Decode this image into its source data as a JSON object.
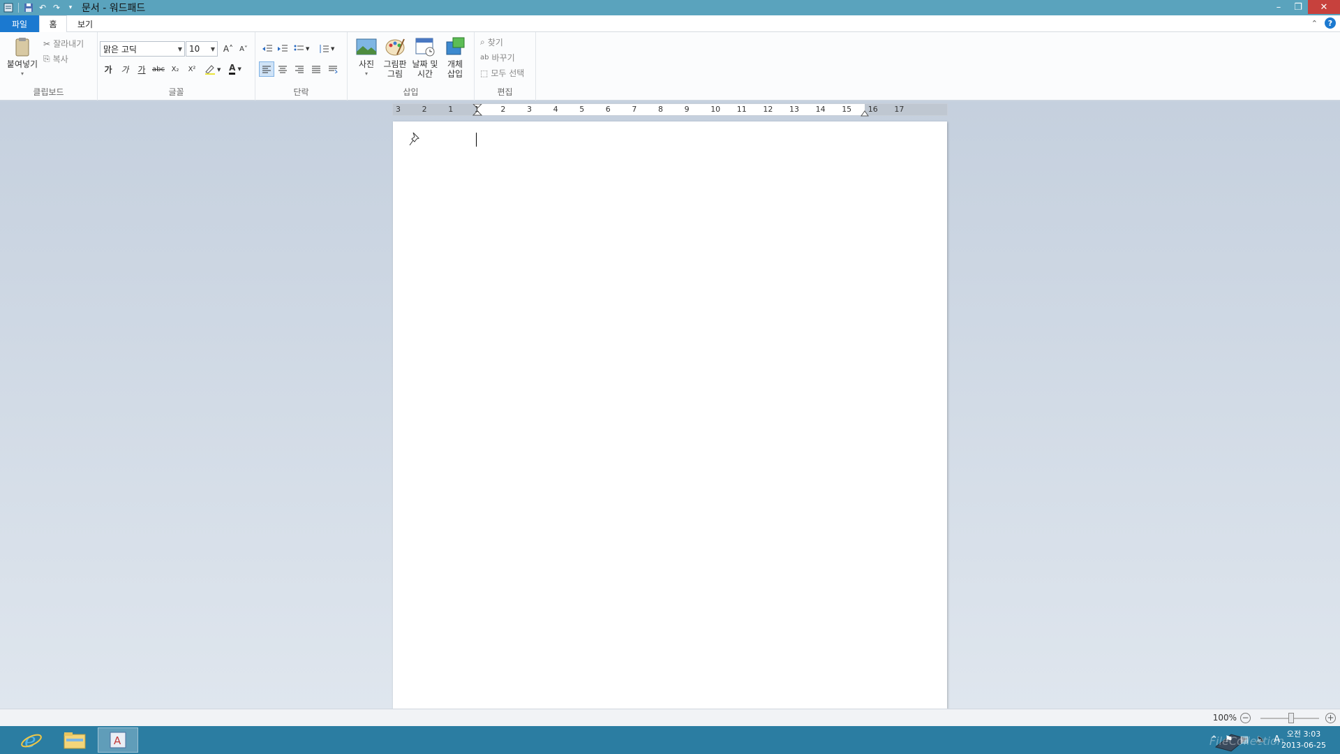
{
  "window": {
    "title": "문서 - 워드패드",
    "controls": [
      "–",
      "❐",
      "✕"
    ]
  },
  "tabs": [
    {
      "label": "파일"
    },
    {
      "label": "홈"
    },
    {
      "label": "보기"
    }
  ],
  "help_label": "?",
  "ribbon": {
    "clipboard": {
      "label": "클립보드",
      "paste": "붙여넣기",
      "cut": "잘라내기",
      "copy": "복사"
    },
    "font": {
      "label": "글꼴",
      "family": "맑은 고딕",
      "size": "10",
      "bold": "가",
      "italic": "가",
      "underline": "가",
      "strike": "abc",
      "subscript": "X₂",
      "superscript": "X²",
      "grow": "A˄",
      "shrink": "A˅",
      "color_letter": "A"
    },
    "paragraph": {
      "label": "단락"
    },
    "insert": {
      "label": "삽입",
      "picture": "사진",
      "paint": "그림판\n그림",
      "datetime": "날짜 및\n시간",
      "object": "개체\n삽입"
    },
    "editing": {
      "label": "편집",
      "find": "찾기",
      "replace": "바꾸기",
      "select_all": "모두 선택"
    }
  },
  "ruler": {
    "numbers": [
      "3",
      "2",
      "1",
      "1",
      "2",
      "3",
      "4",
      "5",
      "6",
      "7",
      "8",
      "9",
      "10",
      "11",
      "12",
      "13",
      "14",
      "15",
      "16",
      "17"
    ]
  },
  "status": {
    "zoom": "100%",
    "zoom_minus": "−",
    "zoom_plus": "+"
  },
  "taskbar": {
    "time": "오전 3:03",
    "date": "2013-06-25",
    "ime": "A",
    "watermark": "FileCollection"
  }
}
